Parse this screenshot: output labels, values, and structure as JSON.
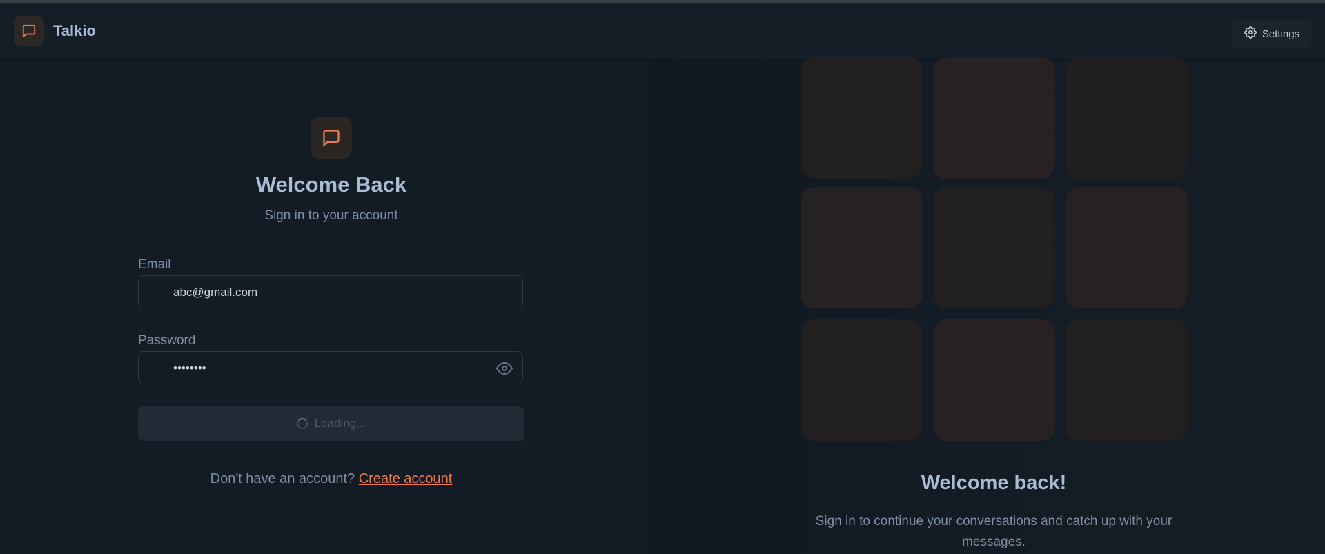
{
  "app": {
    "brand": "Talkio",
    "accent_color": "#f07a4f"
  },
  "navbar": {
    "logo_icon": "chat-bubble-icon",
    "settings_label": "Settings",
    "settings_icon": "gear-icon"
  },
  "login_form": {
    "logo_icon": "chat-bubble-icon",
    "title": "Welcome Back",
    "subtitle": "Sign in to your account",
    "email": {
      "label": "Email",
      "value": "abc@gmail.com"
    },
    "password": {
      "label": "Password",
      "value": "••••••••",
      "toggle_icon": "eye-icon"
    },
    "submit": {
      "label": "Loading...",
      "state": "loading",
      "icon": "spinner-icon"
    },
    "signup": {
      "prompt": "Don't have an account?",
      "link_label": "Create account"
    }
  },
  "promo": {
    "tile_colors": [
      "#221f21",
      "#272123",
      "#211e20",
      "#262123",
      "#221f21",
      "#272123",
      "#221f21",
      "#272123",
      "#221f21"
    ],
    "title": "Welcome back!",
    "description": "Sign in to continue your conversations and catch up with your messages."
  }
}
